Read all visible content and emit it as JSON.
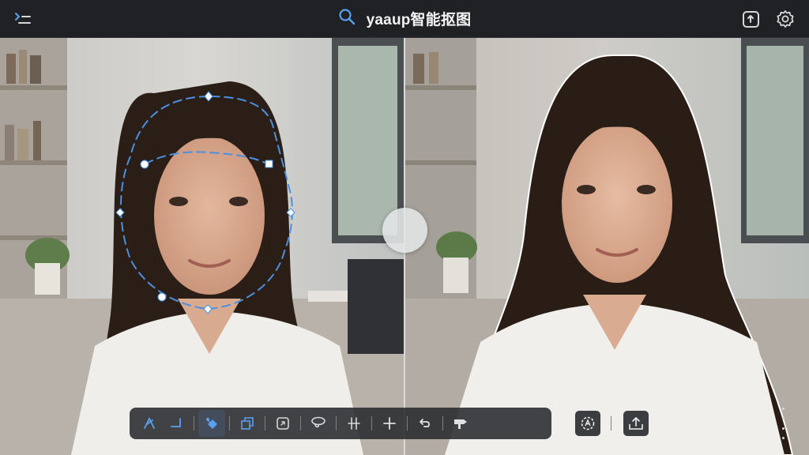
{
  "app": {
    "title": "yaaup智能抠图"
  },
  "header": {
    "menu_icon": "menu-icon",
    "search_icon": "search-icon",
    "export_icon": "export-icon",
    "settings_icon": "gear-icon"
  },
  "canvas": {
    "original_pane": "original-image",
    "result_pane": "cutout-result-image",
    "compare_handle_icon": "compare-handle"
  },
  "toolbar": {
    "tools": [
      {
        "name": "pen-tool",
        "icon": "pen-icon"
      },
      {
        "name": "corner-tool",
        "icon": "corner-icon"
      },
      {
        "name": "eraser-tool",
        "icon": "eraser-icon"
      },
      {
        "name": "layer-tool",
        "icon": "layers-icon"
      },
      {
        "name": "crop-tool",
        "icon": "crop-icon"
      },
      {
        "name": "lasso-tool",
        "icon": "lasso-icon"
      },
      {
        "name": "grid-tool",
        "icon": "grid-icon"
      },
      {
        "name": "add-tool",
        "icon": "plus-icon"
      },
      {
        "name": "undo-tool",
        "icon": "undo-icon"
      },
      {
        "name": "brush-tool",
        "icon": "brush-icon"
      }
    ]
  },
  "actions": {
    "ai_icon": "ai-magic-icon",
    "save_icon": "save-export-icon",
    "more_icon": "more-vertical-icon"
  },
  "colors": {
    "accent_blue": "#4a90e2",
    "topbar_bg": "#1f2124",
    "toolbar_bg": "#2a2c2f"
  }
}
